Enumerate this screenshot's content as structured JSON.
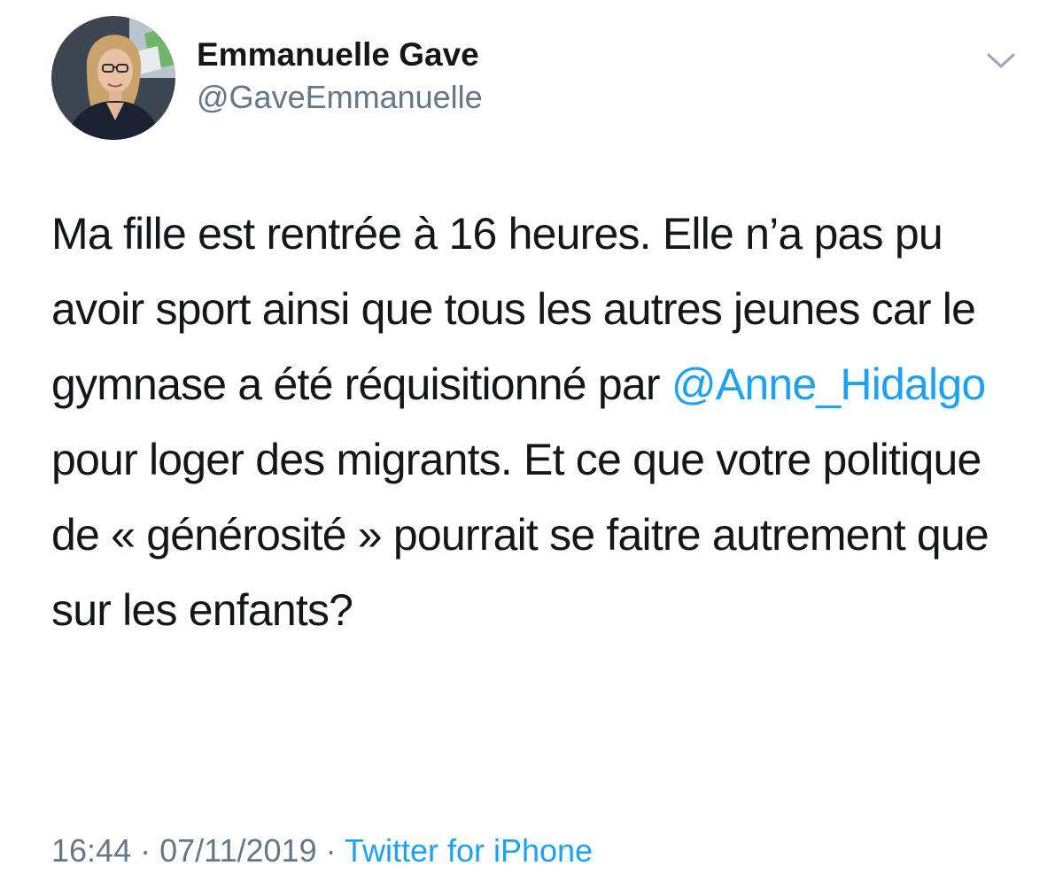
{
  "user": {
    "display_name": "Emmanuelle Gave",
    "handle": "@GaveEmmanuelle"
  },
  "tweet": {
    "text_before_mention": "Ma fille est rentrée à 16 heures. Elle n’a pas pu avoir sport ainsi que tous les autres jeunes car le gymnase a été réquisitionné par ",
    "mention": "@Anne_Hidalgo",
    "text_after_mention": " pour loger des migrants. Et ce que votre politique de « générosité » pourrait se faitre autrement que sur les enfants?"
  },
  "meta": {
    "time": "16:44",
    "separator": " · ",
    "date": "07/11/2019",
    "source": "Twitter for iPhone"
  },
  "colors": {
    "link": "#1da1f2",
    "secondary_text": "#657786",
    "primary_text": "#14171a",
    "chevron": "#9aa7b3"
  }
}
